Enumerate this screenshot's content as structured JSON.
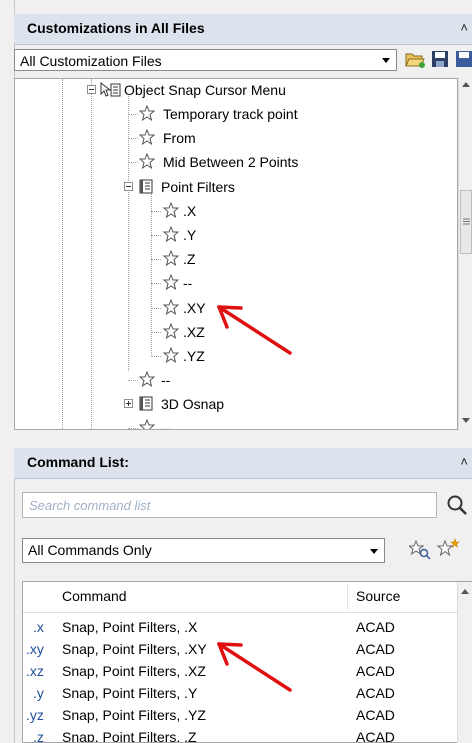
{
  "customizations": {
    "title": "Customizations in All Files",
    "file_filter": "All Customization Files",
    "tree": [
      {
        "label": "Object Snap Cursor Menu",
        "type": "menu",
        "level": 0
      },
      {
        "label": "Temporary track point",
        "type": "command",
        "level": 1
      },
      {
        "label": "From",
        "type": "command",
        "level": 1
      },
      {
        "label": "Mid Between 2 Points",
        "type": "command",
        "level": 1
      },
      {
        "label": "Point Filters",
        "type": "menu",
        "level": 1
      },
      {
        "label": ".X",
        "type": "command",
        "level": 2
      },
      {
        "label": ".Y",
        "type": "command",
        "level": 2
      },
      {
        "label": ".Z",
        "type": "command",
        "level": 2
      },
      {
        "label": "--",
        "type": "separator",
        "level": 2
      },
      {
        "label": ".XY",
        "type": "command",
        "level": 2
      },
      {
        "label": ".XZ",
        "type": "command",
        "level": 2
      },
      {
        "label": ".YZ",
        "type": "command",
        "level": 2
      },
      {
        "label": "--",
        "type": "separator",
        "level": 1
      },
      {
        "label": "3D Osnap",
        "type": "menu",
        "level": 1
      },
      {
        "label": "--",
        "type": "separator",
        "level": 1
      }
    ]
  },
  "command_list": {
    "title": "Command List:",
    "search_placeholder": "Search command list",
    "filter": "All Commands Only",
    "columns": {
      "command": "Command",
      "source": "Source"
    },
    "rows": [
      {
        "abbr": ".x",
        "command": "Snap, Point Filters, .X",
        "source": "ACAD"
      },
      {
        "abbr": ".xy",
        "command": "Snap, Point Filters, .XY",
        "source": "ACAD"
      },
      {
        "abbr": ".xz",
        "command": "Snap, Point Filters, .XZ",
        "source": "ACAD"
      },
      {
        "abbr": ".y",
        "command": "Snap, Point Filters, .Y",
        "source": "ACAD"
      },
      {
        "abbr": ".yz",
        "command": "Snap, Point Filters, .YZ",
        "source": "ACAD"
      },
      {
        "abbr": ".z",
        "command": "Snap, Point Filters, .Z",
        "source": "ACAD"
      }
    ]
  },
  "colors": {
    "annotation_arrow": "#e01010",
    "header_bg": "#dde3ec"
  }
}
